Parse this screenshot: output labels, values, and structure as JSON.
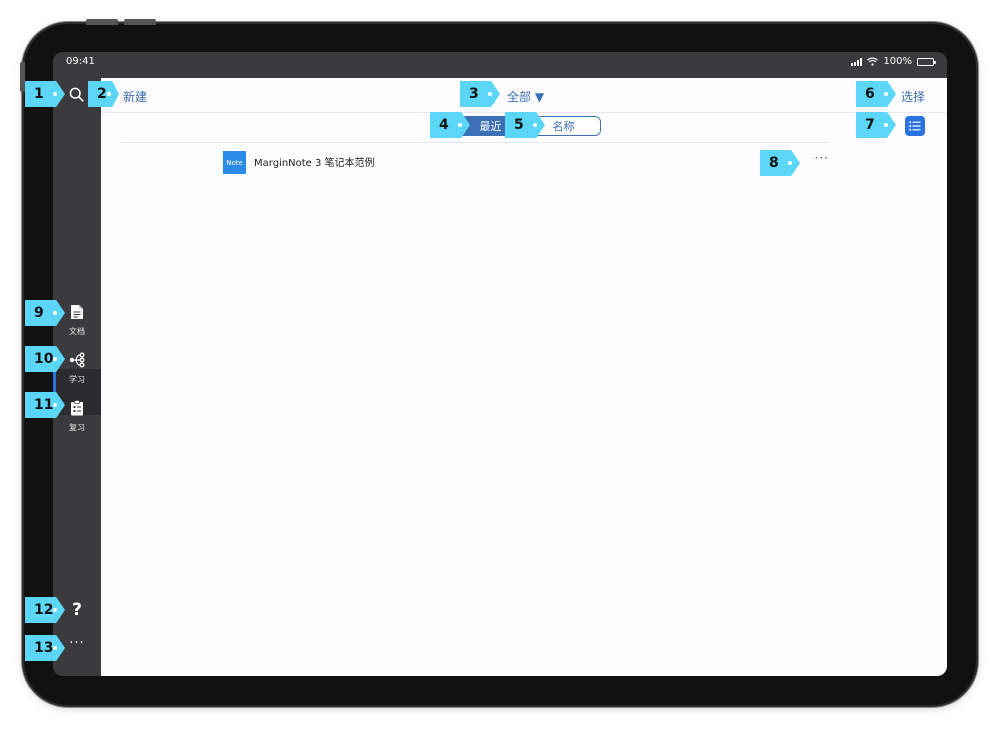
{
  "statusbar": {
    "time": "09:41",
    "battery": "100%",
    "battery_level": 1.0
  },
  "header": {
    "new_label": "新建",
    "filter_label": "全部 ▼",
    "select_label": "选择"
  },
  "sort": {
    "recent_label": "最近",
    "name_label": "名称",
    "active": "recent"
  },
  "notebooks": [
    {
      "thumb_label": "Note",
      "title": "MarginNote 3 笔记本范例",
      "more_label": "···"
    }
  ],
  "sidebar": {
    "items": [
      {
        "label": "文档",
        "icon": "document-icon"
      },
      {
        "label": "学习",
        "icon": "mindmap-icon"
      },
      {
        "label": "复习",
        "icon": "clipboard-icon"
      }
    ],
    "help_label": "?",
    "more_label": "···"
  },
  "callouts": [
    "1",
    "2",
    "3",
    "4",
    "5",
    "6",
    "7",
    "8",
    "9",
    "10",
    "11",
    "12",
    "13"
  ],
  "colors": {
    "accent": "#3d6fb4",
    "callout": "#5cd6f6",
    "sidebar": "#3b3b3e",
    "note_thumb": "#2a8ae8"
  }
}
